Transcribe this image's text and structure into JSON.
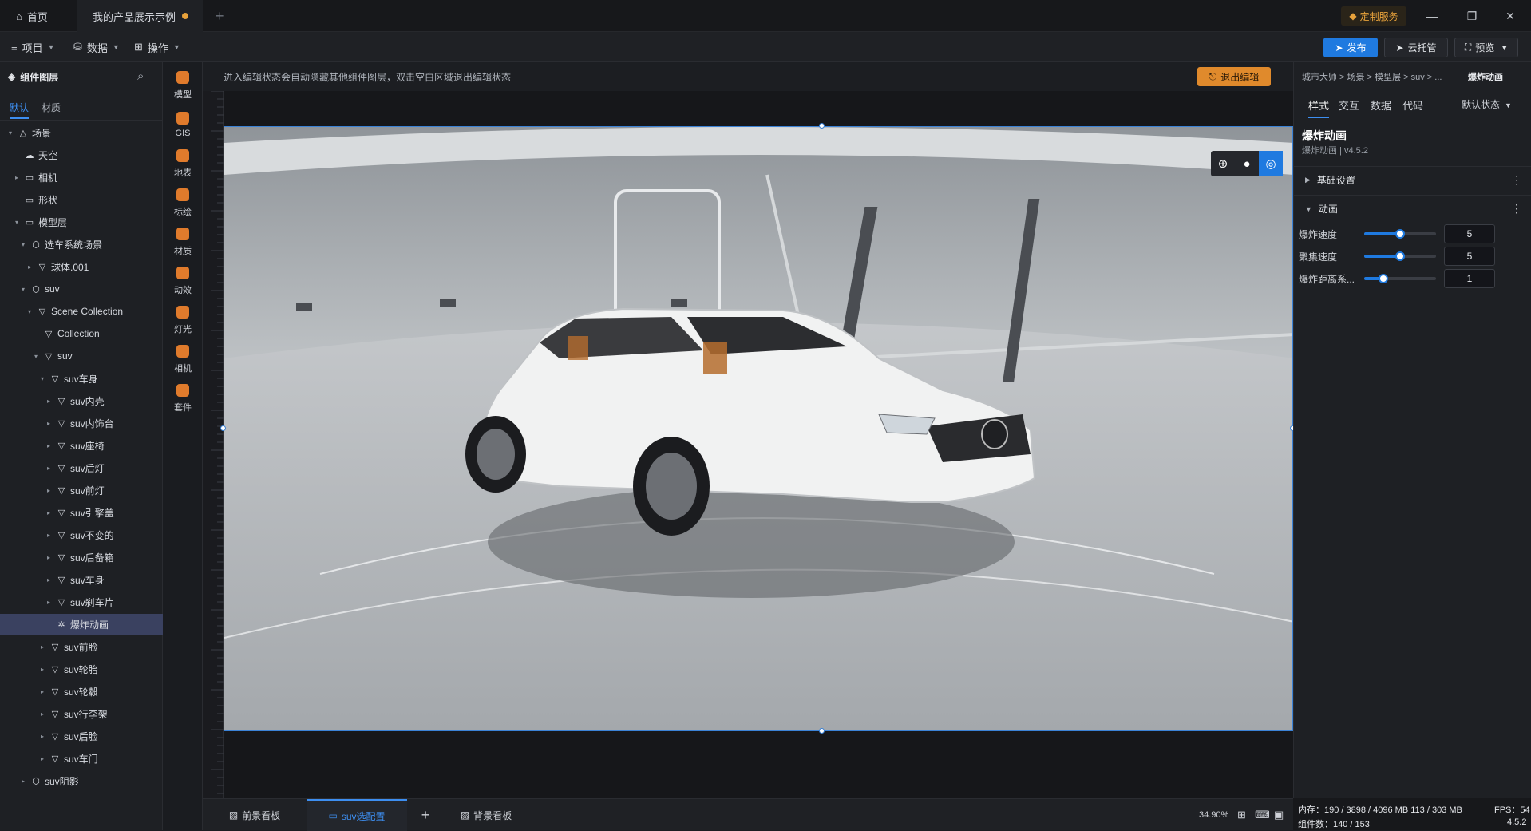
{
  "titlebar": {
    "home_label": "首页",
    "doc_tab_label": "我的产品展示示例",
    "new_tab": "+",
    "custom_service_label": "定制服务",
    "minimize": "—",
    "restore": "❐",
    "close": "✕"
  },
  "menubar": {
    "project": "项目",
    "data": "数据",
    "operate": "操作",
    "publish": "发布",
    "cloud_host": "云托管",
    "preview": "预览"
  },
  "left_panel": {
    "title": "组件图层",
    "tabs": [
      "默认",
      "材质"
    ],
    "tree": [
      {
        "label": "场景",
        "depth": 0,
        "arrow": "▾",
        "icon": "△"
      },
      {
        "label": "天空",
        "depth": 1,
        "arrow": "",
        "icon": "☁"
      },
      {
        "label": "相机",
        "depth": 1,
        "arrow": "▸",
        "icon": "▭"
      },
      {
        "label": "形状",
        "depth": 1,
        "arrow": "",
        "icon": "▭"
      },
      {
        "label": "模型层",
        "depth": 1,
        "arrow": "▾",
        "icon": "▭"
      },
      {
        "label": "选车系统场景",
        "depth": 2,
        "arrow": "▾",
        "icon": "⬡"
      },
      {
        "label": "球体.001",
        "depth": 3,
        "arrow": "▸",
        "icon": "▽"
      },
      {
        "label": "suv",
        "depth": 2,
        "arrow": "▾",
        "icon": "⬡"
      },
      {
        "label": "Scene Collection",
        "depth": 3,
        "arrow": "▾",
        "icon": "▽"
      },
      {
        "label": "Collection",
        "depth": 4,
        "arrow": "",
        "icon": "▽"
      },
      {
        "label": "suv",
        "depth": 4,
        "arrow": "▾",
        "icon": "▽"
      },
      {
        "label": "suv车身",
        "depth": 5,
        "arrow": "▾",
        "icon": "▽"
      },
      {
        "label": "suv内壳",
        "depth": 6,
        "arrow": "▸",
        "icon": "▽"
      },
      {
        "label": "suv内饰台",
        "depth": 6,
        "arrow": "▸",
        "icon": "▽"
      },
      {
        "label": "suv座椅",
        "depth": 6,
        "arrow": "▸",
        "icon": "▽"
      },
      {
        "label": "suv后灯",
        "depth": 6,
        "arrow": "▸",
        "icon": "▽"
      },
      {
        "label": "suv前灯",
        "depth": 6,
        "arrow": "▸",
        "icon": "▽"
      },
      {
        "label": "suv引擎盖",
        "depth": 6,
        "arrow": "▸",
        "icon": "▽"
      },
      {
        "label": "suv不变的",
        "depth": 6,
        "arrow": "▸",
        "icon": "▽"
      },
      {
        "label": "suv后备箱",
        "depth": 6,
        "arrow": "▸",
        "icon": "▽"
      },
      {
        "label": "suv车身",
        "depth": 6,
        "arrow": "▸",
        "icon": "▽"
      },
      {
        "label": "suv刹车片",
        "depth": 6,
        "arrow": "▸",
        "icon": "▽"
      },
      {
        "label": "爆炸动画",
        "depth": 6,
        "arrow": "",
        "icon": "✲",
        "selected": true
      },
      {
        "label": "suv前脸",
        "depth": 5,
        "arrow": "▸",
        "icon": "▽"
      },
      {
        "label": "suv轮胎",
        "depth": 5,
        "arrow": "▸",
        "icon": "▽"
      },
      {
        "label": "suv轮毂",
        "depth": 5,
        "arrow": "▸",
        "icon": "▽"
      },
      {
        "label": "suv行李架",
        "depth": 5,
        "arrow": "▸",
        "icon": "▽"
      },
      {
        "label": "suv后脸",
        "depth": 5,
        "arrow": "▸",
        "icon": "▽"
      },
      {
        "label": "suv车门",
        "depth": 5,
        "arrow": "▸",
        "icon": "▽"
      },
      {
        "label": "suv阴影",
        "depth": 2,
        "arrow": "▸",
        "icon": "⬡"
      }
    ]
  },
  "rail": [
    {
      "label": "模型",
      "icon": "model-icon",
      "color": "#e07b2c"
    },
    {
      "label": "GIS",
      "icon": "globe-icon",
      "color": "#e07b2c"
    },
    {
      "label": "地表",
      "icon": "terrain-icon",
      "color": "#e07b2c"
    },
    {
      "label": "标绘",
      "icon": "pin-icon",
      "color": "#e07b2c"
    },
    {
      "label": "材质",
      "icon": "material-icon",
      "color": "#e07b2c"
    },
    {
      "label": "动效",
      "icon": "star-icon",
      "color": "#e07b2c"
    },
    {
      "label": "灯光",
      "icon": "light-icon",
      "color": "#e07b2c"
    },
    {
      "label": "相机",
      "icon": "camera-icon",
      "color": "#e07b2c"
    },
    {
      "label": "套件",
      "icon": "kit-icon",
      "color": "#e07b2c"
    }
  ],
  "canvas": {
    "hint": "进入编辑状态会自动隐藏其他组件图层，双击空白区域退出编辑状态",
    "exit_edit": "退出编辑"
  },
  "bottom": {
    "tabs": [
      "前景看板",
      "suv选配置",
      "背景看板"
    ],
    "active_tab": 1,
    "add": "+",
    "zoom": "34.90%"
  },
  "right_panel": {
    "breadcrumb": "城市大师 > 场景 > 模型层 > suv > ...",
    "title_right": "爆炸动画",
    "tabs": [
      "样式",
      "交互",
      "数据",
      "代码"
    ],
    "state_select": "默认状态",
    "component_title": "爆炸动画",
    "component_sub": "爆炸动画 | v4.5.2",
    "sections": {
      "basic": "基础设置",
      "animation": "动画"
    },
    "props": [
      {
        "label": "爆炸速度",
        "value": "5",
        "level": 0.5
      },
      {
        "label": "聚集速度",
        "value": "5",
        "level": 0.5
      },
      {
        "label": "爆炸距离系...",
        "value": "1",
        "level": 0.27
      }
    ]
  },
  "status": {
    "memory": "内存：190 / 3898 / 4096 MB  113 / 303 MB",
    "fps": "FPS：54",
    "components": "组件数：140 / 153",
    "version": "4.5.2"
  }
}
